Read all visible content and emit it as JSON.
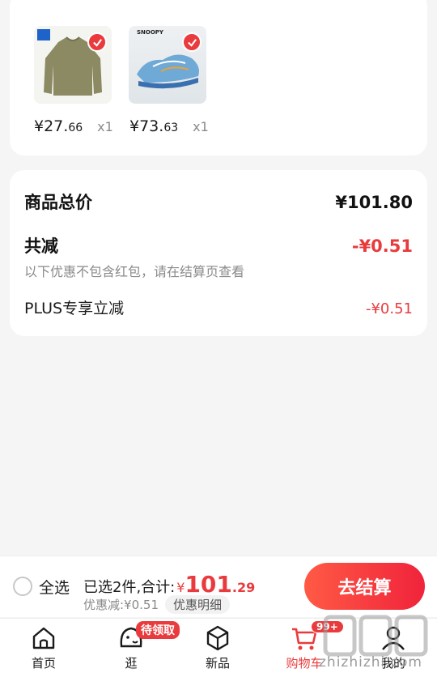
{
  "cart_items": [
    {
      "price_int": "¥27.",
      "price_dec": "66",
      "qty": "x1",
      "thumb_icon": "sweatshirt-image"
    },
    {
      "price_int": "¥73.",
      "price_dec": "63",
      "qty": "x1",
      "thumb_icon": "sneaker-image",
      "brand": "SNOOPY"
    }
  ],
  "summary": {
    "total_label": "商品总价",
    "total_value": "¥101.80",
    "reduce_label": "共减",
    "reduce_value": "-¥0.51",
    "note": "以下优惠不包含红包，请在结算页查看",
    "plus_label": "PLUS专享立减",
    "plus_value": "-¥0.51"
  },
  "checkout": {
    "select_all": "全选",
    "selected_text": "已选2件,合计:",
    "currency": "¥",
    "total_int": "101",
    "total_frac": ".29",
    "discount_text": "优惠减:¥0.51",
    "detail_button": "优惠明细",
    "checkout_button": "去结算"
  },
  "tabbar": {
    "home": "首页",
    "browse": "逛",
    "browse_badge": "待领取",
    "new": "新品",
    "cart": "购物车",
    "cart_badge": "99+",
    "me": "我的"
  },
  "watermark": "zhizhizhi.com",
  "colors": {
    "accent": "#e93b3d",
    "background": "#f5f5f5"
  }
}
